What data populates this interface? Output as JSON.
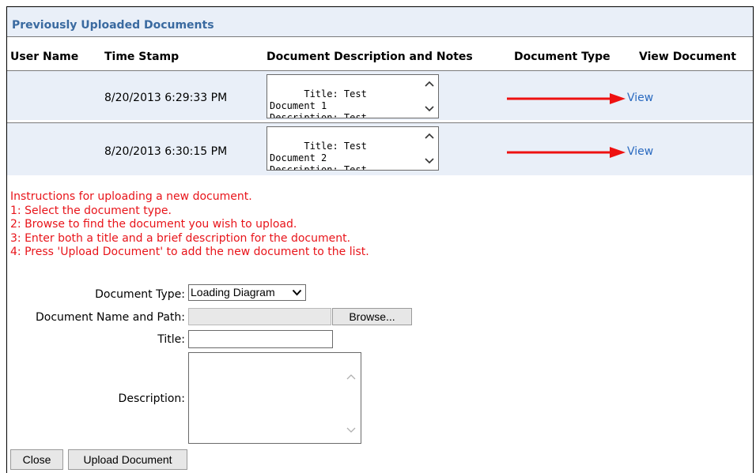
{
  "section": {
    "title": "Previously Uploaded Documents"
  },
  "columns": [
    "User Name",
    "Time Stamp",
    "Document Description and Notes",
    "Document Type",
    "View Document"
  ],
  "rows": [
    {
      "time_stamp": "8/20/2013 6:29:33 PM",
      "notes": "Title: Test\nDocument 1\nDescription: Test",
      "view_label": "View"
    },
    {
      "time_stamp": "8/20/2013 6:30:15 PM",
      "notes": "Title: Test\nDocument 2\nDescription: Test",
      "view_label": "View"
    }
  ],
  "instructions": [
    "Instructions for uploading a new document.",
    "1: Select the document type.",
    "2: Browse to find the document you wish to upload.",
    "3: Enter both a title and a brief description for the document.",
    "4: Press 'Upload Document' to add the new document to the list."
  ],
  "form": {
    "doc_type_label": "Document Type:",
    "doc_type_value": "Loading Diagram",
    "doc_path_label": "Document Name and Path:",
    "browse_label": "Browse...",
    "title_label": "Title:",
    "description_label": "Description:"
  },
  "actions": {
    "close_label": "Close",
    "upload_label": "Upload Document"
  },
  "colors": {
    "row_bg": "#e9eff8",
    "instructions": "#e8141a",
    "link": "#2a6ac0",
    "arrow": "#ee1111",
    "section_title": "#3a6aa0"
  }
}
